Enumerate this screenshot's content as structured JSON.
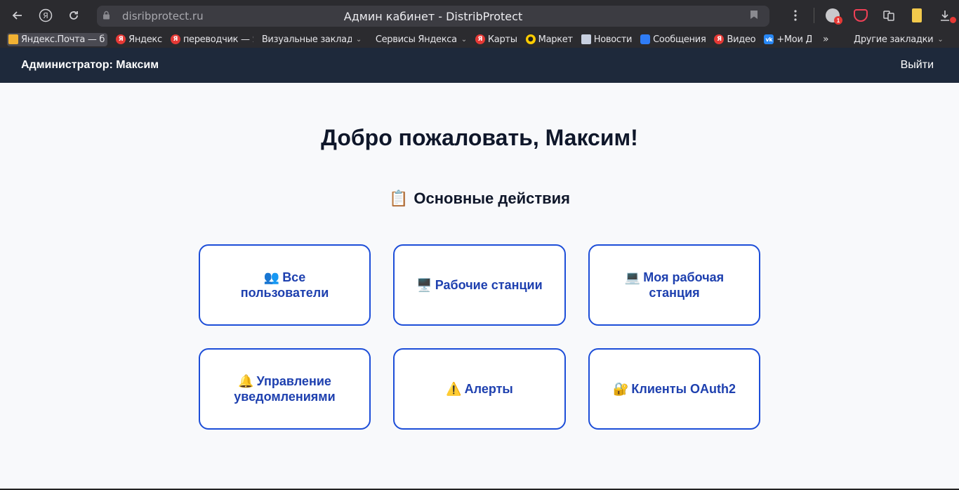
{
  "browser": {
    "url": "disribprotect.ru",
    "tab_title": "Админ кабинет - DistribProtect",
    "badges": {
      "ext1": "1"
    }
  },
  "bookmarks": [
    {
      "label": "Яндекс.Почта — б",
      "icon": "mail-icon",
      "glyph": ""
    },
    {
      "label": "Яндекс",
      "icon": "yandex-icon",
      "glyph": "Я"
    },
    {
      "label": "переводчик — Ян",
      "icon": "yandex-icon",
      "glyph": "Я"
    },
    {
      "label": "Визуальные заклад",
      "icon": "",
      "glyph": ""
    },
    {
      "label": "Сервисы Яндекса",
      "icon": "",
      "glyph": ""
    },
    {
      "label": "Карты",
      "icon": "yandex-icon",
      "glyph": "Я"
    },
    {
      "label": "Маркет",
      "icon": "market-icon",
      "glyph": ""
    },
    {
      "label": "Новости",
      "icon": "news-icon",
      "glyph": ""
    },
    {
      "label": "Сообщения",
      "icon": "message-icon",
      "glyph": ""
    },
    {
      "label": "Видео",
      "icon": "yandex-icon",
      "glyph": "Я"
    },
    {
      "label": "+Мои Д",
      "icon": "vk-icon",
      "glyph": "vk"
    }
  ],
  "bookmarks_other": "Другие закладки",
  "header": {
    "admin": "Администратор: Максим",
    "logout": "Выйти"
  },
  "main": {
    "welcome": "Добро пожаловать, Максим!",
    "section_emoji": "📋",
    "section_title": "Основные действия",
    "cards": [
      {
        "emoji": "👥",
        "label": "Все пользователи"
      },
      {
        "emoji": "🖥️",
        "label": "Рабочие станции"
      },
      {
        "emoji": "💻",
        "label": "Моя рабочая станция"
      },
      {
        "emoji": "🔔",
        "label": "Управление уведомлениями"
      },
      {
        "emoji": "⚠️",
        "label": "Алерты"
      },
      {
        "emoji": "🔐",
        "label": "Клиенты OAuth2"
      }
    ]
  }
}
